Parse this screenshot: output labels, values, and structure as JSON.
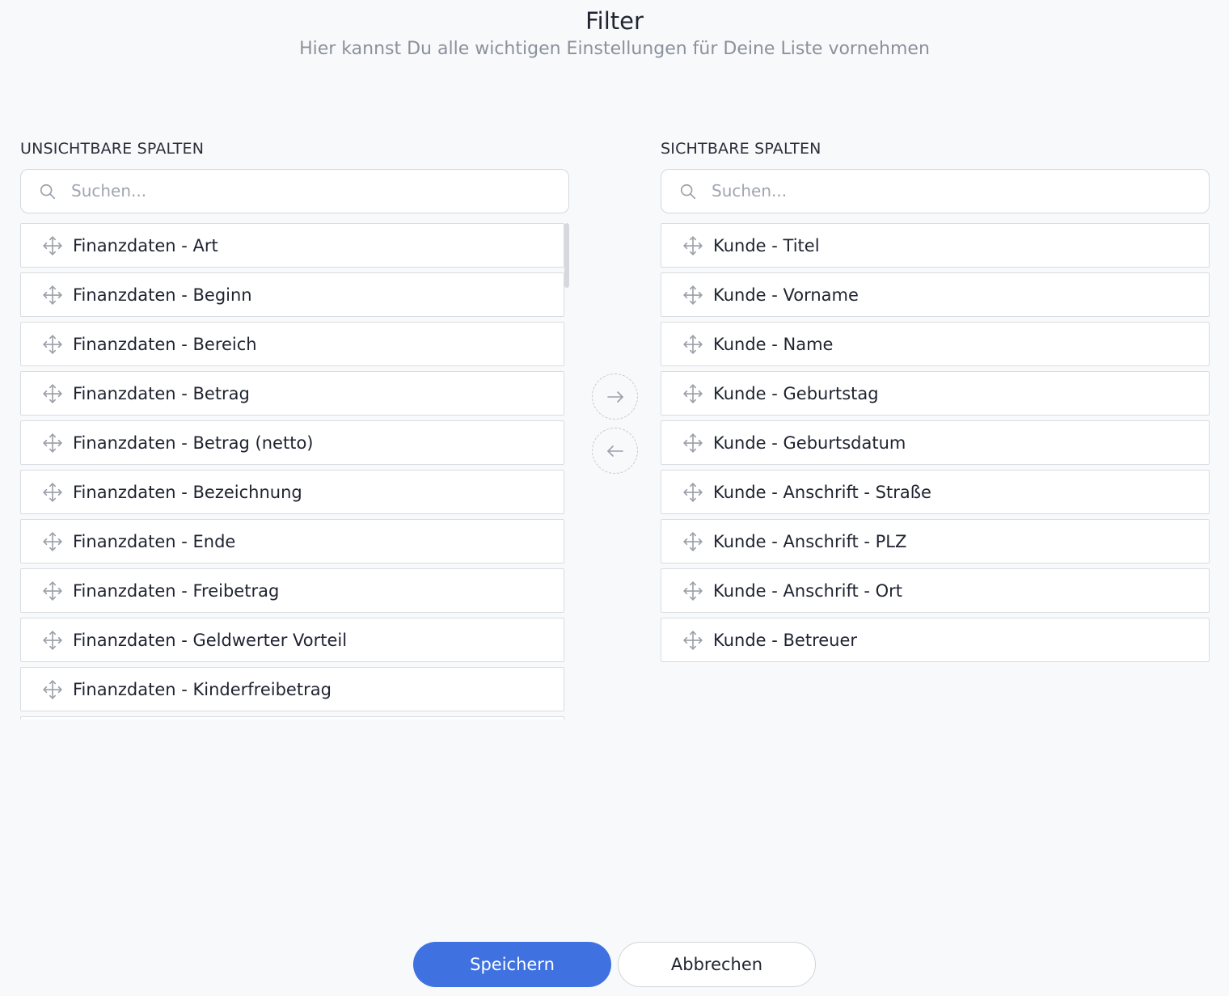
{
  "header": {
    "title": "Filter",
    "subtitle": "Hier kannst Du alle wichtigen Einstellungen für Deine Liste vornehmen"
  },
  "left_column": {
    "heading": "UNSICHTBARE SPALTEN",
    "search_placeholder": "Suchen...",
    "items": [
      "Finanzdaten - Art",
      "Finanzdaten - Beginn",
      "Finanzdaten - Bereich",
      "Finanzdaten - Betrag",
      "Finanzdaten - Betrag (netto)",
      "Finanzdaten - Bezeichnung",
      "Finanzdaten - Ende",
      "Finanzdaten - Freibetrag",
      "Finanzdaten - Geldwerter Vorteil",
      "Finanzdaten - Kinderfreibetrag",
      ""
    ]
  },
  "right_column": {
    "heading": "SICHTBARE SPALTEN",
    "search_placeholder": "Suchen...",
    "items": [
      "Kunde - Titel",
      "Kunde - Vorname",
      "Kunde - Name",
      "Kunde - Geburtstag",
      "Kunde - Geburtsdatum",
      "Kunde - Anschrift - Straße",
      "Kunde - Anschrift - PLZ",
      "Kunde - Anschrift - Ort",
      "Kunde - Betreuer"
    ]
  },
  "transfer": {
    "to_right_icon": "arrow-right-icon",
    "to_left_icon": "arrow-left-icon"
  },
  "footer": {
    "save_label": "Speichern",
    "cancel_label": "Abbrechen"
  },
  "colors": {
    "primary": "#3f72e0",
    "background": "#f8f9fb",
    "border": "#d9dce1",
    "muted_text": "#8b919c"
  }
}
